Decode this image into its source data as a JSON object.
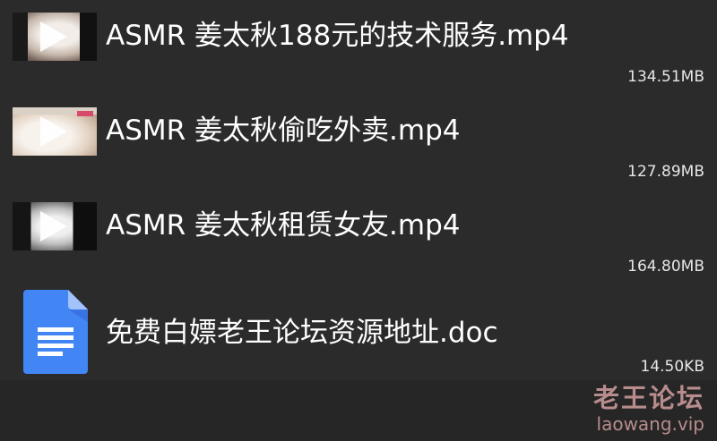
{
  "files": [
    {
      "name": "ASMR 姜太秋188元的技术服务.mp4",
      "size": "134.51MB",
      "type": "video"
    },
    {
      "name": "ASMR 姜太秋偷吃外卖.mp4",
      "size": "127.89MB",
      "type": "video"
    },
    {
      "name": "ASMR 姜太秋租赁女友.mp4",
      "size": "164.80MB",
      "type": "video"
    },
    {
      "name": "免费白嫖老王论坛资源地址.doc",
      "size": "14.50KB",
      "type": "document"
    }
  ],
  "icons": {
    "video": "video-thumbnail-play-icon",
    "document": "google-docs-icon"
  },
  "colors": {
    "background": "#2b2b2b",
    "text": "#ffffff",
    "doc_blue": "#4285f4",
    "watermark": "#c89898"
  },
  "watermark": {
    "title": "老王论坛",
    "url": "laowang.vip"
  }
}
